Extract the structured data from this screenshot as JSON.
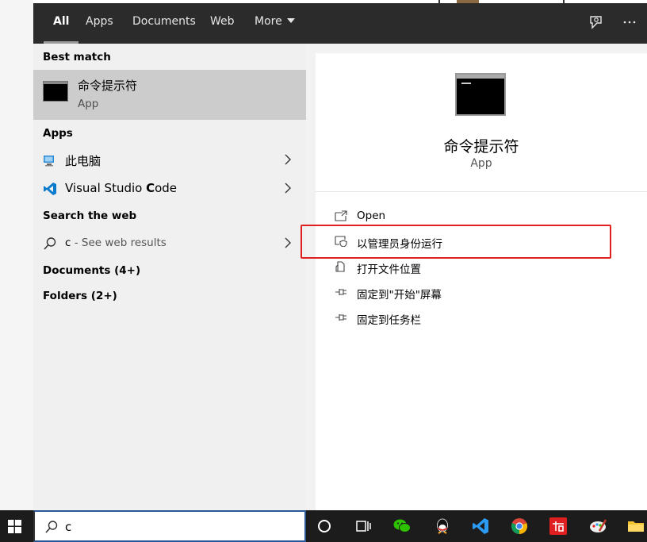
{
  "tabs": [
    {
      "label": "All",
      "active": true
    },
    {
      "label": "Apps"
    },
    {
      "label": "Documents"
    },
    {
      "label": "Web"
    },
    {
      "label": "More"
    }
  ],
  "topbar_icons": [
    "feedback-icon",
    "more-options-icon"
  ],
  "left": {
    "best_match_header": "Best match",
    "best_match": {
      "title": "命令提示符",
      "subtitle": "App"
    },
    "apps_header": "Apps",
    "apps": [
      {
        "label": "此电脑",
        "icon": "this-pc-icon"
      },
      {
        "label_pre": "Visual Studio ",
        "label_bold": "C",
        "label_post": "ode",
        "icon": "vscode-icon"
      }
    ],
    "web_header": "Search the web",
    "web_result": {
      "query": "c",
      "suffix": " - See web results"
    },
    "documents": "Documents (4+)",
    "folders": "Folders (2+)"
  },
  "right": {
    "title": "命令提示符",
    "subtitle": "App",
    "actions": [
      {
        "label": "Open",
        "icon": "open-icon"
      },
      {
        "label": "以管理员身份运行",
        "icon": "run-as-admin-icon"
      },
      {
        "label": "打开文件位置",
        "icon": "file-location-icon"
      },
      {
        "label": "固定到\"开始\"屏幕",
        "icon": "pin-icon"
      },
      {
        "label": "固定到任务栏",
        "icon": "pin-icon"
      }
    ]
  },
  "search": {
    "value": "c"
  },
  "taskbar_icons": [
    "windows-start-icon",
    "cortana-icon",
    "task-view-icon",
    "wechat-icon",
    "qq-icon",
    "vscode-icon",
    "chrome-icon",
    "youdao-icon",
    "paint-icon",
    "file-explorer-icon"
  ],
  "colors": {
    "accent_highlight": "#e02020",
    "topbar": "#2b2b2b",
    "selected_row": "#cccccc",
    "taskbar": "#1c1c1c"
  }
}
